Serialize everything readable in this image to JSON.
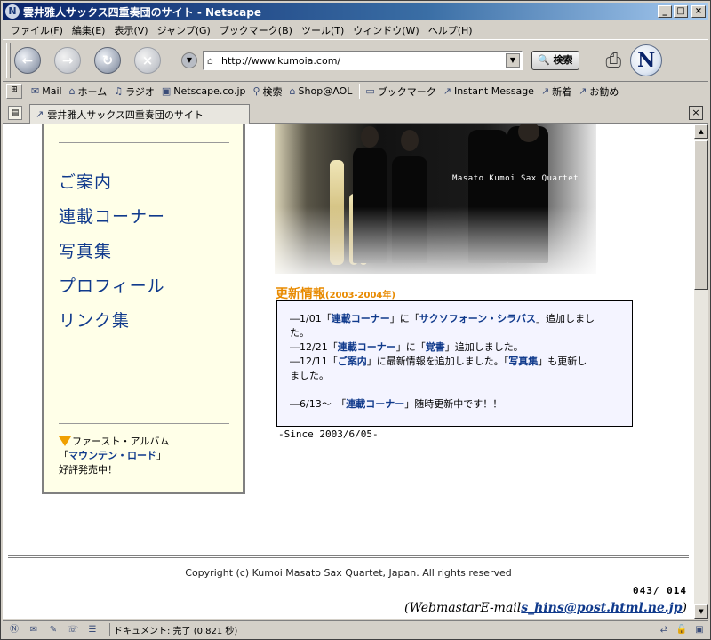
{
  "window": {
    "title": "雲井雅人サックス四重奏団のサイト - Netscape",
    "app_icon": "N"
  },
  "menu": [
    "ファイル(F)",
    "編集(E)",
    "表示(V)",
    "ジャンプ(G)",
    "ブックマーク(B)",
    "ツール(T)",
    "ウィンドウ(W)",
    "ヘルプ(H)"
  ],
  "toolbar": {
    "url": "http://www.kumoia.com/",
    "search_label": "検索",
    "logo": "N"
  },
  "personal_toolbar": {
    "items": [
      "Mail",
      "ホーム",
      "ラジオ",
      "Netscape.co.jp",
      "検索",
      "Shop@AOL",
      "ブックマーク",
      "Instant Message",
      "新着",
      "お勧め"
    ]
  },
  "tab": {
    "label": "雲井雅人サックス四重奏団のサイト"
  },
  "sidebar": {
    "links": [
      "ご案内",
      "連載コーナー",
      "写真集",
      "プロフィール",
      "リンク集"
    ],
    "promo_line1": "ファースト・アルバム",
    "promo_open": "「",
    "promo_album": "マウンテン・ロード",
    "promo_close": "」",
    "promo_line3": "好評発売中！"
  },
  "photo": {
    "caption": "Masato Kumoi Sax Quartet"
  },
  "news": {
    "title": "更新情報",
    "title_range": "(2003-2004年)",
    "line1_a": "―1/01「",
    "line1_link1": "連載コーナー",
    "line1_b": "」に「",
    "line1_link2": "サクソフォーン・シラバス",
    "line1_c": "」追加しまし",
    "line1_d": "た。",
    "line2_a": "―12/21「",
    "line2_link1": "連載コーナー",
    "line2_b": "」に「",
    "line2_link2": "覚書",
    "line2_c": "」追加しました。",
    "line3_a": "―12/11「",
    "line3_link1": "ご案内",
    "line3_b": "」に最新情報を追加しました。「",
    "line3_link2": "写真集",
    "line3_c": "」も更新し",
    "line3_d": "ました。",
    "line4_a": "―6/13～　「",
    "line4_link": "連載コーナー",
    "line4_b": "」随時更新中です！！",
    "since": "-Since 2003/6/05-"
  },
  "footer": {
    "copyright": "Copyright (c) Kumoi Masato Sax Quartet, Japan. All rights reserved",
    "counter": "043/ 014",
    "webmaster_prefix": "(WebmastarE-mail",
    "webmaster_email": "s_hins@post.html.ne.jp",
    "webmaster_suffix": ")"
  },
  "statusbar": {
    "text": "ドキュメント: 完了 (0.821 秒)"
  }
}
